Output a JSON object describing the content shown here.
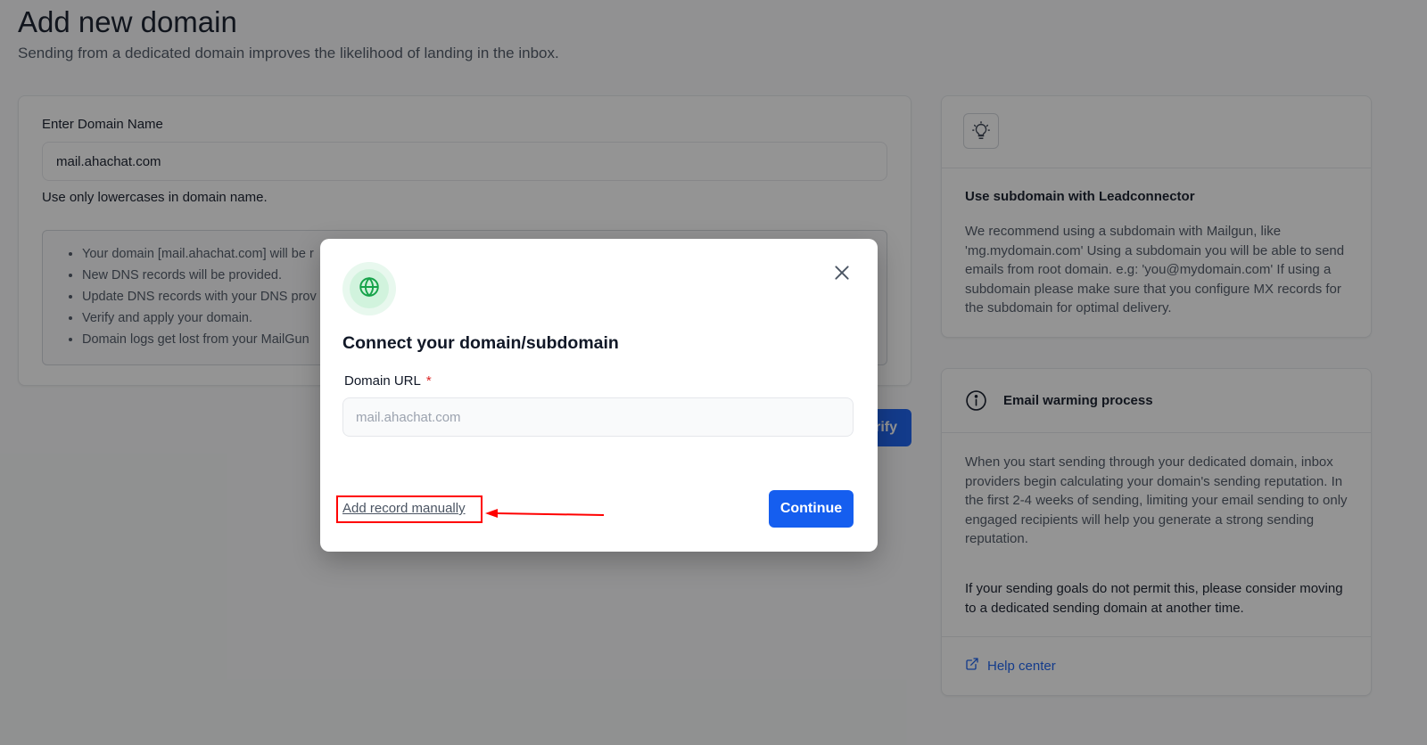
{
  "header": {
    "title": "Add new domain",
    "subtitle": "Sending from a dedicated domain improves the likelihood of landing in the inbox."
  },
  "main_card": {
    "field_label": "Enter Domain Name",
    "domain_value": "mail.ahachat.com",
    "hint": "Use only lowercases in domain name.",
    "bullets": [
      "Your domain [mail.ahachat.com] will be r",
      "New DNS records will be provided.",
      "Update DNS records with your DNS prov",
      "Verify and apply your domain.",
      "Domain logs get lost from your MailGun"
    ],
    "verify_label": "rify"
  },
  "tip_card": {
    "icon": "lightbulb-icon",
    "title": "Use subdomain with Leadconnector",
    "body": "We recommend using a subdomain with Mailgun, like 'mg.mydomain.com' Using a subdomain you will be able to send emails from root domain. e.g: 'you@mydomain.com' If using a subdomain please make sure that you configure MX records for the subdomain for optimal delivery."
  },
  "warming_card": {
    "icon": "info-icon",
    "title": "Email warming process",
    "body": "When you start sending through your dedicated domain, inbox providers begin calculating your domain's sending reputation. In the first 2-4 weeks of sending, limiting your email sending to only engaged recipients will help you generate a strong sending reputation.",
    "note": "If your sending goals do not permit this, please consider moving to a dedicated sending domain at another time.",
    "help_label": "Help center",
    "help_icon": "external-link-icon"
  },
  "modal": {
    "icon": "globe-icon",
    "title": "Connect your domain/subdomain",
    "field_label": "Domain URL",
    "required_mark": "*",
    "input_placeholder": "mail.ahachat.com",
    "input_value": "",
    "manual_link": "Add record manually",
    "continue_label": "Continue"
  },
  "colors": {
    "primary": "#155eef",
    "annotation_red": "#ff0000",
    "globe_green": "#16a34a"
  }
}
